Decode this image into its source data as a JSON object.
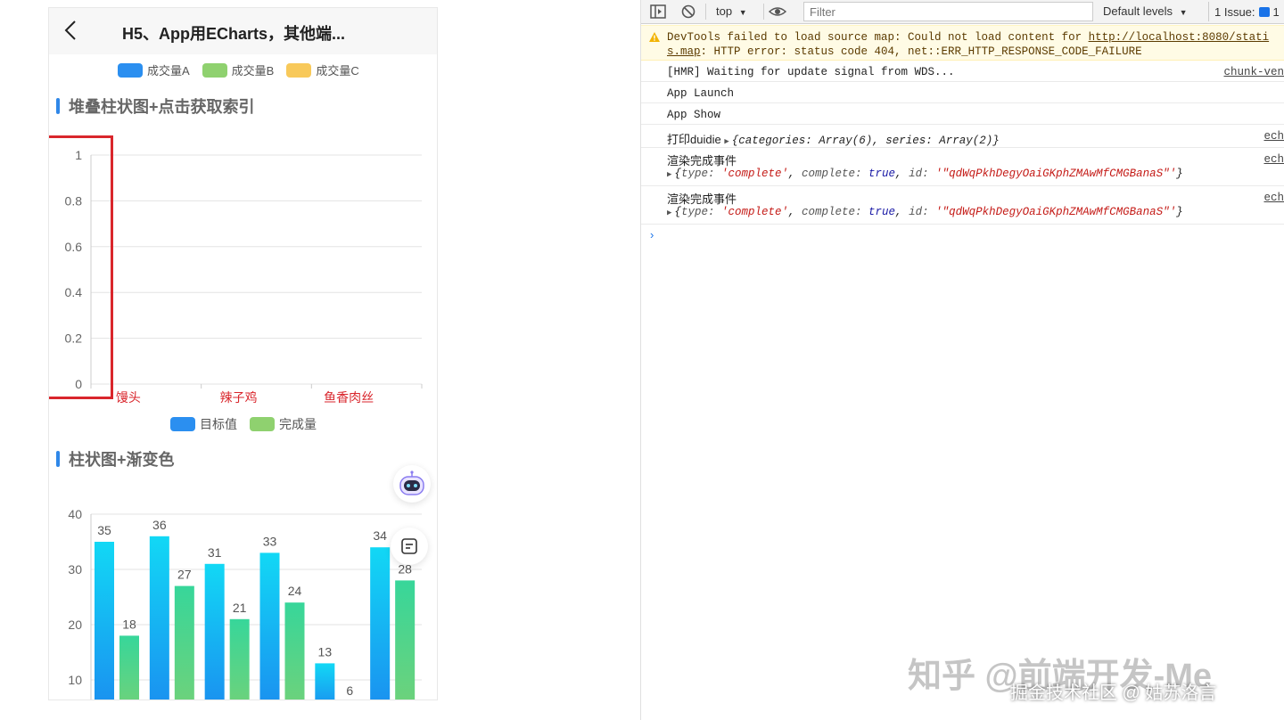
{
  "app": {
    "nav_title": "H5、App用ECharts，其他端...",
    "top_legend": [
      {
        "label": "成交量A",
        "color": "#2b8ff0"
      },
      {
        "label": "成交量B",
        "color": "#8fd16f"
      },
      {
        "label": "成交量C",
        "color": "#f8c95a"
      }
    ],
    "section1_title": "堆叠柱状图+点击获取索引",
    "section2_title": "柱状图+渐变色",
    "chart1_legend": [
      {
        "label": "目标值",
        "color": "#2b8ff0"
      },
      {
        "label": "完成量",
        "color": "#8fd16f"
      }
    ],
    "accent_color": "#2f87e8"
  },
  "chart_data": [
    {
      "type": "bar",
      "stacked": true,
      "categories": [
        "馒头",
        "辣子鸡",
        "鱼香肉丝"
      ],
      "series": [
        {
          "name": "目标值",
          "values": []
        },
        {
          "name": "完成量",
          "values": []
        }
      ],
      "ylim": [
        0,
        1
      ],
      "yticks": [
        "0",
        "0.2",
        "0.4",
        "0.6",
        "0.8",
        "1"
      ],
      "grid": true,
      "legend_position": "bottom",
      "category_label_color": "#d9262c",
      "annotation": "red highlight box around y-axis"
    },
    {
      "type": "bar",
      "gradient": true,
      "yticks": [
        "10",
        "20",
        "30",
        "40"
      ],
      "ylim": [
        5,
        40
      ],
      "grid": true,
      "groups": [
        {
          "a": 35,
          "b": 18
        },
        {
          "a": 36,
          "b": 27
        },
        {
          "a": 31,
          "b": 21
        },
        {
          "a": 33,
          "b": 24
        },
        {
          "a": 13,
          "b": 6
        },
        {
          "a": 34,
          "b": 28
        }
      ],
      "visible_labels": {
        "a": [
          "35",
          "36",
          "31",
          "33",
          "13",
          "34"
        ],
        "b": [
          "18",
          "27",
          "21",
          "24",
          "6",
          "28"
        ]
      },
      "colors": {
        "a_top": "#12d8f5",
        "a_bottom": "#1a90f0",
        "b_top": "#37d69a",
        "b_bottom": "#6fd27a"
      }
    }
  ],
  "devtools": {
    "context": "top",
    "filter_placeholder": "Filter",
    "levels": "Default levels",
    "issues": "1 Issue:",
    "issues_count": "1",
    "warn": {
      "line1_prefix": "DevTools failed to load source map: Could not load content for ",
      "line1_link": "http://localhost:8080/stati",
      "line2_link": "s.map",
      "line2_rest": ": HTTP error: status code 404, net::ERR_HTTP_RESPONSE_CODE_FAILURE"
    },
    "logs": [
      {
        "text": "[HMR] Waiting for update signal from WDS...",
        "src": "chunk-ven"
      },
      {
        "text": "App Launch",
        "src": ""
      },
      {
        "text": "App Show",
        "src": ""
      },
      {
        "label": "打印duidie",
        "obj": "{categories: Array(6), series: Array(2)}",
        "src": "ech"
      },
      {
        "label": "渲染完成事件",
        "obj_type": "'complete'",
        "obj_complete": "true",
        "obj_id": "'\"qdWqPkhDegyOaiGKphZMAwMfCMGBanaS\"'",
        "src": "ech"
      },
      {
        "label": "渲染完成事件",
        "obj_type": "'complete'",
        "obj_complete": "true",
        "obj_id": "'\"qdWqPkhDegyOaiGKphZMAwMfCMGBanaS\"'",
        "src": "ech"
      }
    ]
  },
  "watermark": {
    "main": "知乎 @前端开发-Me",
    "sub": "掘金技术社区 @ 姑苏洛言"
  }
}
